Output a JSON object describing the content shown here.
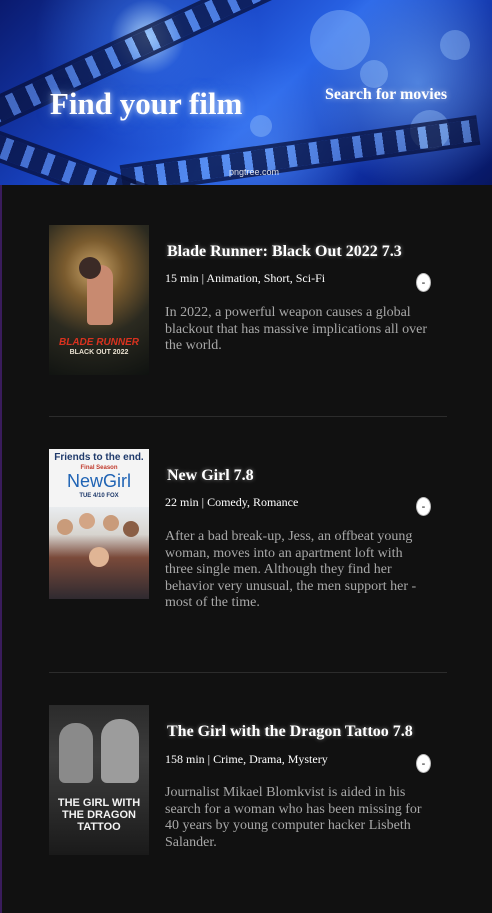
{
  "header": {
    "title": "Find your film",
    "search_link": "Search for movies",
    "watermark": "pngtree.com"
  },
  "movies": [
    {
      "title": "Blade Runner: Black Out 2022 7.3",
      "meta": "15 min | Animation, Short, Sci-Fi",
      "plot": "In 2022, a powerful weapon causes a global blackout that has massive implications all over the world.",
      "toggle": "-",
      "poster_title": "BLADE RUNNER",
      "poster_subtitle": "BLACK OUT 2022"
    },
    {
      "title": "New Girl 7.8",
      "meta": "22 min | Comedy, Romance",
      "plot": "After a bad break-up, Jess, an offbeat young woman, moves into an apartment loft with three single men. Although they find her behavior very unusual, the men support her - most of the time.",
      "toggle": "-",
      "poster_tagline": "Friends to the end.",
      "poster_season": "Final Season",
      "poster_title": "NewGirl",
      "poster_date": "TUE 4/10 FOX"
    },
    {
      "title": "The Girl with the Dragon Tattoo 7.8",
      "meta": "158 min | Crime, Drama, Mystery",
      "plot": "Journalist Mikael Blomkvist is aided in his search for a woman who has been missing for 40 years by young computer hacker Lisbeth Salander.",
      "toggle": "-",
      "poster_title": "THE GIRL WITH THE DRAGON TATTOO"
    }
  ]
}
